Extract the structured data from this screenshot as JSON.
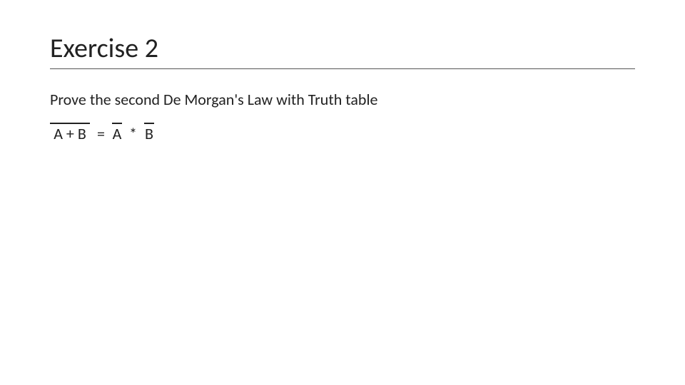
{
  "slide": {
    "title": "Exercise 2",
    "body": "Prove the second De Morgan's Law with Truth table",
    "equation": {
      "lhs": "A + B",
      "eq": "=",
      "rhs_a": "A",
      "star": "*",
      "rhs_b": "B",
      "plain": "A + B  = A  * B"
    }
  }
}
